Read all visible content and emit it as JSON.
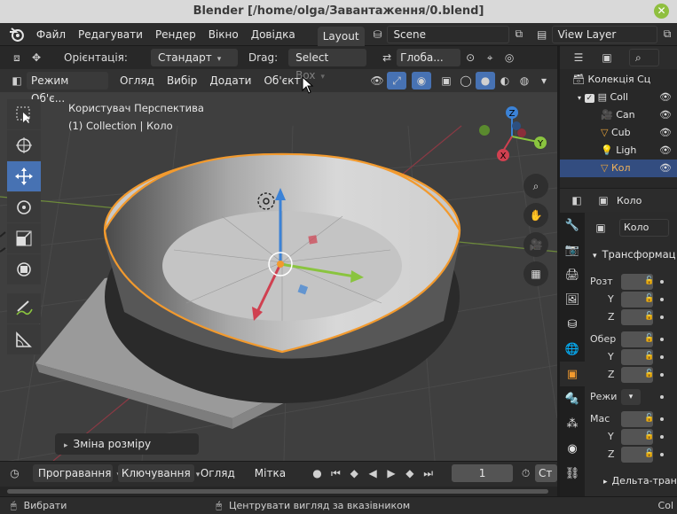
{
  "window": {
    "title": "Blender [/home/olga/Завантаження/0.blend]"
  },
  "menubar": {
    "items": [
      "Файл",
      "Редагувати",
      "Рендер",
      "Вікно",
      "Довідка"
    ],
    "workspace_tab": "Layout",
    "scene_name": "Scene",
    "view_layer": "View Layer"
  },
  "viewport_header": {
    "orientation_label": "Орієнтація:",
    "orientation_value": "Стандарт",
    "drag_label": "Drag:",
    "drag_value": "Select Box",
    "transform_global": "Глоба...",
    "mode": "Режим Об'є...",
    "menu": [
      "Огляд",
      "Вибір",
      "Додати",
      "Об'єкт"
    ]
  },
  "viewport": {
    "view_name": "Користувач Перспектива",
    "collection_info": "(1) Collection | Коло",
    "last_operator": "Зміна розміру",
    "gizmo_axes": [
      "X",
      "Y",
      "Z"
    ]
  },
  "timeline": {
    "playback": "Програвання",
    "keying": "Ключування",
    "view": "Огляд",
    "marker": "Мітка",
    "current_frame": "1",
    "start_label": "Ст"
  },
  "statusbar": {
    "left": "Вибрати",
    "center": "Центрувати вигляд за вказівником",
    "right": "Col"
  },
  "outliner": {
    "collection_root": "Колекція Сц",
    "items": [
      {
        "name": "Coll",
        "type": "collection"
      },
      {
        "name": "Can",
        "type": "camera"
      },
      {
        "name": "Cub",
        "type": "mesh"
      },
      {
        "name": "Ligh",
        "type": "light"
      },
      {
        "name": "Кол",
        "type": "mesh",
        "selected": true
      }
    ]
  },
  "properties": {
    "object_name": "Коло",
    "object_field": "Коло",
    "panel_title": "Трансформац",
    "location_label": "Розт",
    "rotation_label": "Обер",
    "mode_label": "Режи",
    "scale_label": "Мас",
    "axes": [
      "Y",
      "Z"
    ],
    "delta_panel": "Дельта-тран"
  },
  "colors": {
    "accent": "#4772b3",
    "selection_outline": "#f29a2e",
    "axis_x": "#d04050",
    "axis_y": "#8ac43f",
    "axis_z": "#3b82d6"
  }
}
